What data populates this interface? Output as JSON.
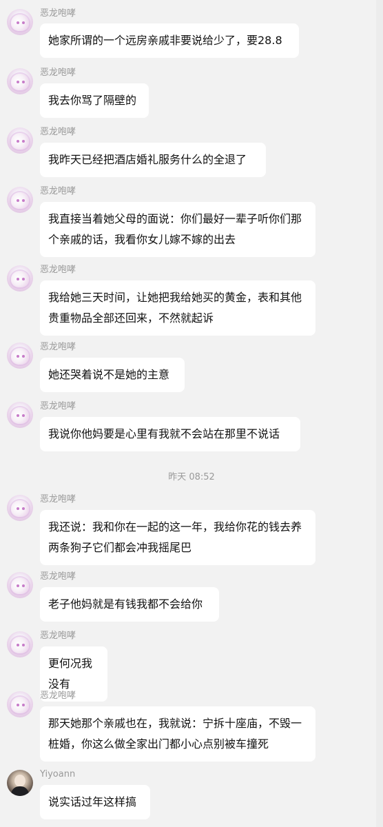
{
  "conversation": {
    "messages": [
      {
        "sender": "恶龙咆哮",
        "avatar": "dragon-girl-avatar",
        "text": "她家所谓的一个远房亲戚非要说给少了，要28.8"
      },
      {
        "sender": "恶龙咆哮",
        "avatar": "dragon-girl-avatar",
        "text": "我去你骂了隔壁的"
      },
      {
        "sender": "恶龙咆哮",
        "avatar": "dragon-girl-avatar",
        "text": "我昨天已经把酒店婚礼服务什么的全退了"
      },
      {
        "sender": "恶龙咆哮",
        "avatar": "dragon-girl-avatar",
        "text": "我直接当着她父母的面说：你们最好一辈子听你们那个亲戚的话，我看你女儿嫁不嫁的出去"
      },
      {
        "sender": "恶龙咆哮",
        "avatar": "dragon-girl-avatar",
        "text": "我给她三天时间，让她把我给她买的黄金，表和其他贵重物品全部还回来，不然就起诉"
      },
      {
        "sender": "恶龙咆哮",
        "avatar": "dragon-girl-avatar",
        "text": "她还哭着说不是她的主意"
      },
      {
        "sender": "恶龙咆哮",
        "avatar": "dragon-girl-avatar",
        "text": "我说你他妈要是心里有我就不会站在那里不说话"
      },
      {
        "sender": "恶龙咆哮",
        "avatar": "dragon-girl-avatar",
        "text": "我还说：我和你在一起的这一年，我给你花的钱去养两条狗子它们都会冲我摇尾巴"
      },
      {
        "sender": "恶龙咆哮",
        "avatar": "dragon-girl-avatar",
        "text": "老子他妈就是有钱我都不会给你"
      },
      {
        "sender": "恶龙咆哮",
        "avatar": "dragon-girl-avatar",
        "text": "更何况我没有"
      },
      {
        "sender": "恶龙咆哮",
        "avatar": "dragon-girl-avatar",
        "text": "那天她那个亲戚也在，我就说：宁拆十座庙，不毁一桩婚，你这么做全家出门都小心点别被车撞死"
      },
      {
        "sender": "Yiyoann",
        "avatar": "yiyoann-avatar",
        "text": "说实话过年这样搞"
      }
    ],
    "timestamp": "昨天 08:52"
  }
}
